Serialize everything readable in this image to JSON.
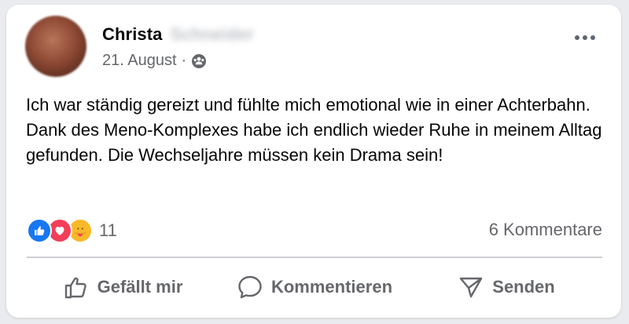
{
  "post": {
    "author_first_name": "Christa",
    "author_last_name_blurred": "Schneider",
    "date": "21. August",
    "separator": "·",
    "audience_icon": "friends-icon",
    "more_icon": "more-options-icon",
    "text": "Ich war ständig gereizt und fühlte mich emotional wie in einer Achterbahn. Dank des Meno-Komplexes habe ich endlich wieder Ruhe in meinem Alltag gefunden. Die Wechseljahre müssen kein Drama sein!"
  },
  "reactions": {
    "types": [
      "like",
      "love",
      "care"
    ],
    "count": "11",
    "comments": "6 Kommentare"
  },
  "actions": {
    "like_label": "Gefällt mir",
    "comment_label": "Kommentieren",
    "share_label": "Senden"
  },
  "colors": {
    "text": "#050505",
    "secondary": "#65676b",
    "like_blue": "#1877f2",
    "love_red": "#f33e58",
    "care_yellow": "#f7b928"
  }
}
